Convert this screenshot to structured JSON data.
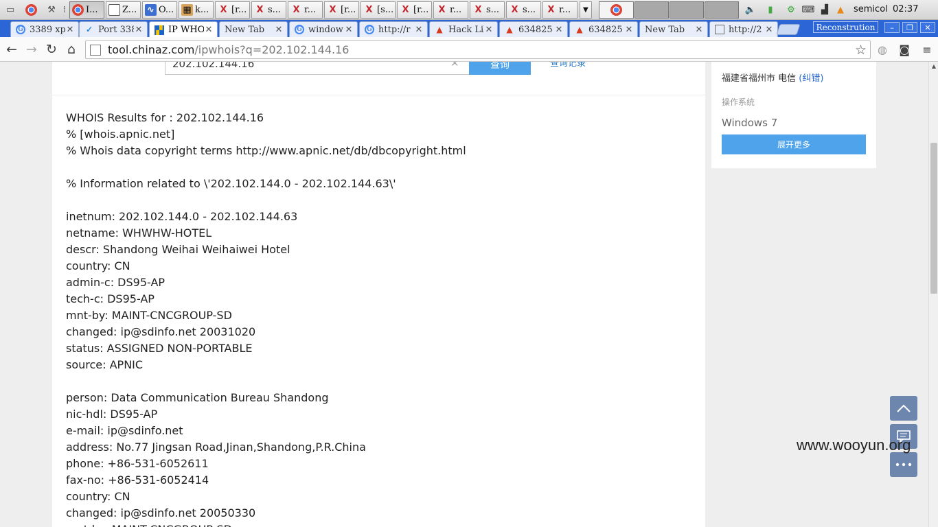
{
  "taskbar": {
    "windows": [
      {
        "icon": "chrome-icon",
        "label": "I..."
      },
      {
        "icon": "window-icon",
        "label": "Z..."
      },
      {
        "icon": "chart-icon",
        "label": "O..."
      },
      {
        "icon": "package-icon",
        "label": "k..."
      },
      {
        "icon": "x-app-icon",
        "label": "[r..."
      },
      {
        "icon": "x-app-icon",
        "label": "s..."
      },
      {
        "icon": "x-app-icon",
        "label": "r..."
      },
      {
        "icon": "x-app-icon",
        "label": "[r..."
      },
      {
        "icon": "x-app-icon",
        "label": "[s..."
      },
      {
        "icon": "x-app-icon",
        "label": "[r..."
      },
      {
        "icon": "x-app-icon",
        "label": "r..."
      },
      {
        "icon": "x-app-icon",
        "label": "s..."
      },
      {
        "icon": "x-app-icon",
        "label": "s..."
      },
      {
        "icon": "x-app-icon",
        "label": "r..."
      }
    ],
    "username": "semicol",
    "clock": "02:37"
  },
  "tabs": [
    {
      "label": "3389 xp",
      "favicon": "google-icon"
    },
    {
      "label": "Port 338",
      "favicon": "check-icon"
    },
    {
      "label": "IP WHO",
      "favicon": "chinaz-icon"
    },
    {
      "label": "New Tab",
      "favicon": ""
    },
    {
      "label": "window",
      "favicon": "google-icon"
    },
    {
      "label": "http://r",
      "favicon": "google-icon"
    },
    {
      "label": "Hack Lil",
      "favicon": "fire-icon"
    },
    {
      "label": "634825",
      "favicon": "fire-icon"
    },
    {
      "label": "634825",
      "favicon": "fire-icon"
    },
    {
      "label": "New Tab",
      "favicon": ""
    },
    {
      "label": "http://2",
      "favicon": "page-icon"
    }
  ],
  "profile_label": "Reconstrution",
  "address": {
    "host": "tool.chinaz.com",
    "path": "/ipwhois?q=202.102.144.16"
  },
  "search": {
    "value": "202.102.144.16",
    "button": "查询",
    "history_link": "查询记录"
  },
  "whois_lines": [
    "WHOIS Results for : 202.102.144.16",
    "% [whois.apnic.net]",
    "% Whois data copyright terms http://www.apnic.net/db/dbcopyright.html",
    "",
    "% Information related to \\'202.102.144.0 - 202.102.144.63\\'",
    "",
    "inetnum: 202.102.144.0 - 202.102.144.63",
    "netname: WHWHW-HOTEL",
    "descr: Shandong Weihai Weihaiwei Hotel",
    "country: CN",
    "admin-c: DS95-AP",
    "tech-c: DS95-AP",
    "mnt-by: MAINT-CNCGROUP-SD",
    "changed: ip@sdinfo.net 20031020",
    "status: ASSIGNED NON-PORTABLE",
    "source: APNIC",
    "",
    "person: Data Communication Bureau Shandong",
    "nic-hdl: DS95-AP",
    "e-mail: ip@sdinfo.net",
    "address: No.77 Jingsan Road,Jinan,Shandong,P.R.China",
    "phone: +86-531-6052611",
    "fax-no: +86-531-6052414",
    "country: CN",
    "changed: ip@sdinfo.net 20050330",
    "mnt-by: MAINT-CNCGROUP-SD"
  ],
  "sidebar": {
    "location": "福建省福州市 电信",
    "correction": "(纠错)",
    "os_label": "操作系统",
    "os_value": "Windows 7",
    "expand_button": "展开更多"
  },
  "watermark": "www.wooyun.org",
  "colors": {
    "tabstrip": "#2c66d6",
    "accent_button": "#4fa3ea",
    "float_button": "#6d86ad"
  }
}
